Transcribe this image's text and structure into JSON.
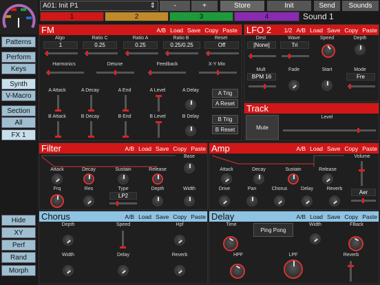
{
  "topbar": {
    "preset": "A01: Init P1",
    "minus": "-",
    "plus": "+",
    "store": "Store",
    "init": "Init",
    "send": "Send",
    "sounds": "Sounds"
  },
  "slots": [
    "1",
    "2",
    "3",
    "4"
  ],
  "slot_colors": [
    "#d11717",
    "#c08a2a",
    "#1e9a3a",
    "#8a2ab0"
  ],
  "sound_label": "Sound 1",
  "sidebar": {
    "patterns": "Patterns",
    "perform": "Perform",
    "keys": "Keys",
    "synth": "Synth",
    "vmacro": "V-Macro",
    "section": "Section",
    "all": "All",
    "fx1": "FX 1",
    "hide": "Hide",
    "xy": "XY",
    "perf": "Perf",
    "rand": "Rand",
    "morph": "Morph"
  },
  "headers": {
    "ab": "A/B",
    "load": "Load",
    "save": "Save",
    "copy": "Copy",
    "paste": "Paste",
    "lfo_page": "1/2"
  },
  "fm": {
    "title": "FM",
    "algo": "Algo",
    "algo_v": "1",
    "ratio_c": "Ratio C",
    "ratio_c_v": "0.25",
    "ratio_a": "Ratio A",
    "ratio_a_v": "0.25",
    "ratio_b": "Ratio B",
    "ratio_b_v": "0.25/0.25",
    "reset": "Reset",
    "reset_v": "Off",
    "harmonics": "Harmonics",
    "detune": "Detune",
    "feedback": "Feedback",
    "xy_mix": "X-Y Mix",
    "a_attack": "A Attack",
    "a_decay": "A Decay",
    "a_end": "A End",
    "a_level": "A Level",
    "a_delay": "A Delay",
    "a_trig": "A Trig",
    "a_reset": "A Reset",
    "b_attack": "B Attack",
    "b_decay": "B Decay",
    "b_end": "B End",
    "b_level": "B Level",
    "b_delay": "B Delay",
    "b_trig": "B Trig",
    "b_reset": "B Reset"
  },
  "lfo": {
    "title": "LFO 2",
    "dest": "Dest",
    "dest_v": "[None]",
    "wave": "Wave",
    "wave_v": "Tri",
    "speed": "Speed",
    "depth": "Depth",
    "mult": "Mult",
    "mult_v": "BPM 16",
    "fade": "Fade",
    "start": "Start",
    "mode": "Mode",
    "mode_v": "Fre"
  },
  "track": {
    "title": "Track",
    "mute": "Mute",
    "level": "Level"
  },
  "filter": {
    "title": "Filter",
    "base": "Base",
    "attack": "Attack",
    "decay": "Decay",
    "sustain": "Sustain",
    "release": "Release",
    "frq": "Frq",
    "res": "Res",
    "type": "Type",
    "type_v": "LP2",
    "depth": "Depth",
    "width": "Width"
  },
  "amp": {
    "title": "Amp",
    "attack": "Attack",
    "decay": "Decay",
    "sustain": "Sustain",
    "release": "Release",
    "volume": "Volume",
    "drive": "Drive",
    "pan": "Pan",
    "chorus": "Chorus",
    "delay": "Delay",
    "reverb": "Reverb",
    "aer": "Aer"
  },
  "chorus": {
    "title": "Chorus",
    "depth": "Depth",
    "speed": "Speed",
    "hpf": "Hpf",
    "width": "Width",
    "delay": "Delay",
    "reverb": "Reverb"
  },
  "delay": {
    "title": "Delay",
    "time": "Time",
    "pingpong": "Ping Pong",
    "width": "Width",
    "fback": "FBack",
    "hpf": "HPF",
    "lpf": "LPF",
    "reverb": "Reverb"
  }
}
